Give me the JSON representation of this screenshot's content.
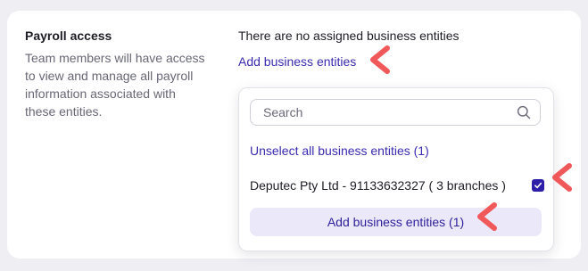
{
  "section": {
    "title": "Payroll access",
    "description": "Team members will have access to view and manage all payroll information associated with these entities."
  },
  "entities": {
    "empty_message": "There are no assigned business entities",
    "add_link": "Add business entities"
  },
  "dropdown": {
    "search_placeholder": "Search",
    "unselect_all": "Unselect all business entities (1)",
    "items": [
      {
        "label": "Deputec Pty Ltd - 91133632327 ( 3 branches )",
        "checked": true
      }
    ],
    "add_button": "Add business entities (1)"
  },
  "colors": {
    "accent": "#3a2bb0",
    "checkbox": "#2d1fa8",
    "button_bg": "#ebe8fa",
    "annotation_arrow": "#f0585a"
  },
  "icons": {
    "search": "search-icon",
    "check": "checkmark-icon",
    "annotation": "annotation-arrow-icon"
  }
}
